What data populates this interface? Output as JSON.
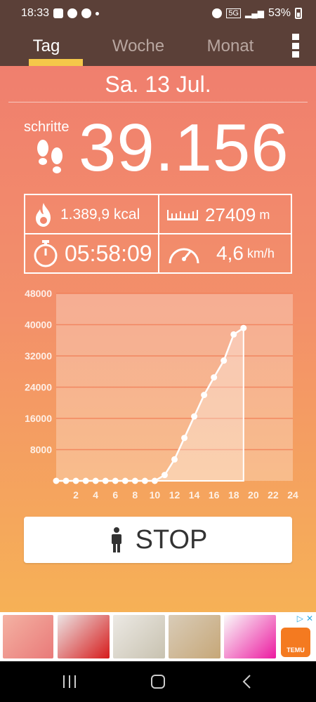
{
  "status_bar": {
    "time": "18:33",
    "network_label": "5G",
    "battery_text": "53%"
  },
  "tabs": [
    {
      "label": "Tag",
      "active": true
    },
    {
      "label": "Woche",
      "active": false
    },
    {
      "label": "Monat",
      "active": false
    }
  ],
  "date": "Sa. 13 Jul.",
  "steps": {
    "label": "schritte",
    "value": "39.156"
  },
  "stats": {
    "calories": "1.389,9 kcal",
    "distance_value": "27409",
    "distance_unit": "m",
    "duration": "05:58:09",
    "speed_value": "4,6",
    "speed_unit": "km/h"
  },
  "stop_button": {
    "label": "STOP"
  },
  "icons": {
    "steps": "footprints-icon",
    "calories": "flame-icon",
    "distance": "ruler-icon",
    "duration": "stopwatch-icon",
    "speed": "speedometer-icon",
    "stop": "person-icon"
  },
  "colors": {
    "header": "#5b4038",
    "tab_indicator": "#f5c84a",
    "gradient_top": "#f07f6e",
    "gradient_bottom": "#f6b156"
  },
  "chart_data": {
    "type": "area",
    "x": [
      0,
      1,
      2,
      3,
      4,
      5,
      6,
      7,
      8,
      9,
      10,
      11,
      12,
      13,
      14,
      15,
      16,
      17,
      18,
      19
    ],
    "y": [
      0,
      0,
      0,
      0,
      0,
      0,
      0,
      0,
      0,
      0,
      0,
      1500,
      5500,
      11000,
      16500,
      22000,
      26500,
      30800,
      37500,
      39156
    ],
    "x_ticks": [
      "2",
      "4",
      "6",
      "8",
      "10",
      "12",
      "14",
      "16",
      "18",
      "20",
      "22",
      "24"
    ],
    "y_ticks": [
      "8000",
      "16000",
      "24000",
      "32000",
      "40000",
      "48000"
    ],
    "xlim": [
      0,
      24
    ],
    "ylim": [
      0,
      48000
    ],
    "grid": true,
    "legend": "none"
  }
}
